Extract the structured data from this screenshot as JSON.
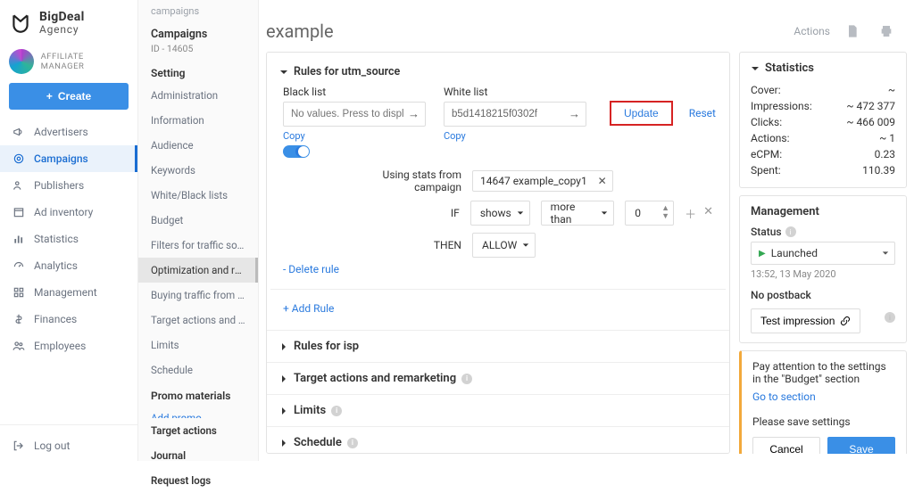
{
  "brand": {
    "name": "BigDeal",
    "sub": "Agency"
  },
  "profile": {
    "role": "AFFILIATE MANAGER"
  },
  "create_btn": "Create",
  "main_nav": [
    {
      "label": "Advertisers",
      "icon": "megaphone"
    },
    {
      "label": "Campaigns",
      "icon": "target",
      "active": true
    },
    {
      "label": "Publishers",
      "icon": "users"
    },
    {
      "label": "Ad inventory",
      "icon": "calendar"
    },
    {
      "label": "Statistics",
      "icon": "bars"
    },
    {
      "label": "Analytics",
      "icon": "gauge"
    },
    {
      "label": "Management",
      "icon": "grid"
    },
    {
      "label": "Finances",
      "icon": "dollar"
    },
    {
      "label": "Employees",
      "icon": "people"
    }
  ],
  "logout": "Log out",
  "sub_breadcrumb": "campaigns",
  "campaign": {
    "title": "Campaigns",
    "id_label": "ID - 14605"
  },
  "sub_groups": {
    "setting": {
      "title": "Setting",
      "items": [
        "Administration",
        "Information",
        "Audience",
        "Keywords",
        "White/Black lists",
        "Budget",
        "Filters for traffic sour…",
        "Optimization and rules",
        "Buying traffic from S…",
        "Target actions and re…",
        "Limits",
        "Schedule"
      ],
      "active_index": 7
    },
    "promo": {
      "title": "Promo materials",
      "add": "Add promo"
    },
    "other": [
      "Target actions",
      "Journal",
      "Request logs"
    ]
  },
  "page_title": "example",
  "actions_label": "Actions",
  "rules": {
    "section_title": "Rules for utm_source",
    "black": {
      "label": "Black list",
      "placeholder": "No values. Press to displ…",
      "copy": "Copy"
    },
    "white": {
      "label": "White list",
      "value": "b5d1418215f0302f",
      "copy": "Copy"
    },
    "update": "Update",
    "reset": "Reset",
    "using_label": "Using stats from campaign",
    "campaign_chip": "14647 example_copy1",
    "if_label": "IF",
    "if_metric": "shows",
    "if_op": "more than",
    "if_val": "0",
    "then_label": "THEN",
    "then_action": "ALLOW",
    "delete": "- Delete rule",
    "add": "+ Add Rule",
    "isp_title": "Rules for isp"
  },
  "collapsed_sections": [
    "Target actions and remarketing",
    "Limits",
    "Schedule"
  ],
  "stats": {
    "title": "Statistics",
    "rows": [
      {
        "k": "Cover:",
        "v": "~"
      },
      {
        "k": "Impressions:",
        "v": "~ 472 377"
      },
      {
        "k": "Clicks:",
        "v": "~ 466 009"
      },
      {
        "k": "Actions:",
        "v": "~ 1"
      },
      {
        "k": "eCPM:",
        "v": "0.23"
      },
      {
        "k": "Spent:",
        "v": "110.39"
      }
    ]
  },
  "mgmt": {
    "title": "Management",
    "status_label": "Status",
    "status_value": "Launched",
    "timestamp": "13:52, 13 May 2020",
    "no_postback": "No postback",
    "test": "Test impression"
  },
  "warn": {
    "note": "Pay attention to the settings in the \"Budget\" section",
    "goto": "Go to section",
    "please": "Please save settings",
    "cancel": "Cancel",
    "save": "Save"
  }
}
